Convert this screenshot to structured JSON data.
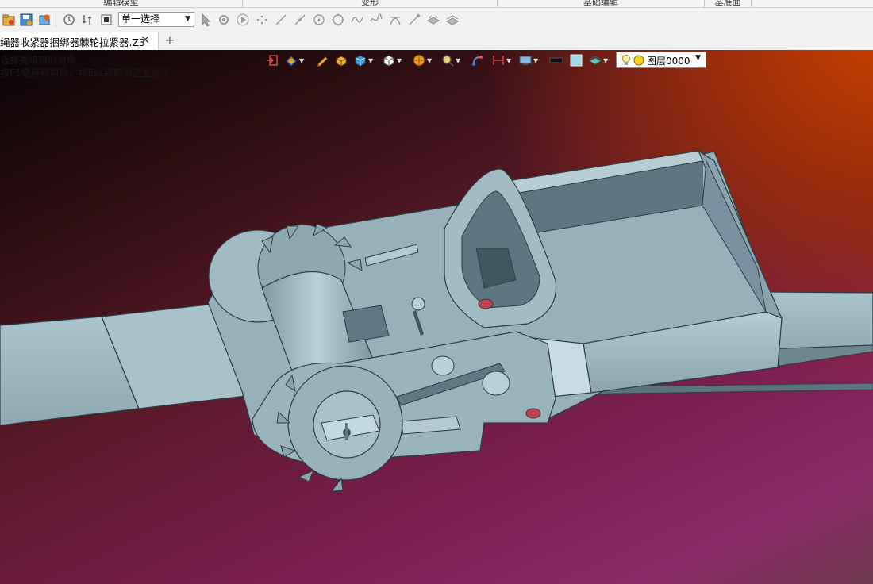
{
  "ribbon": {
    "groups": [
      {
        "label": "编辑模型"
      },
      {
        "label": "变形"
      },
      {
        "label": "基础编辑"
      },
      {
        "label": "基准面"
      }
    ]
  },
  "toolbar": {
    "select_mode": "单一选择"
  },
  "tabs": {
    "document_title": "绳器收紧器捆绑器棘轮拉紧器.Z3",
    "close_glyph": "✕",
    "add_glyph": "+"
  },
  "viewport": {
    "hint_line1": "选择要编辑的对象",
    "hint_line2": "按F1键获得帮助，按Esc键取消这些提示。",
    "layer_name": "图层0000",
    "colors": {
      "part_fill": "#9fb8c0",
      "part_edge": "#2d3c44",
      "bg_top_right": "#c84000",
      "bg_bottom_left": "#8a2a68"
    }
  }
}
